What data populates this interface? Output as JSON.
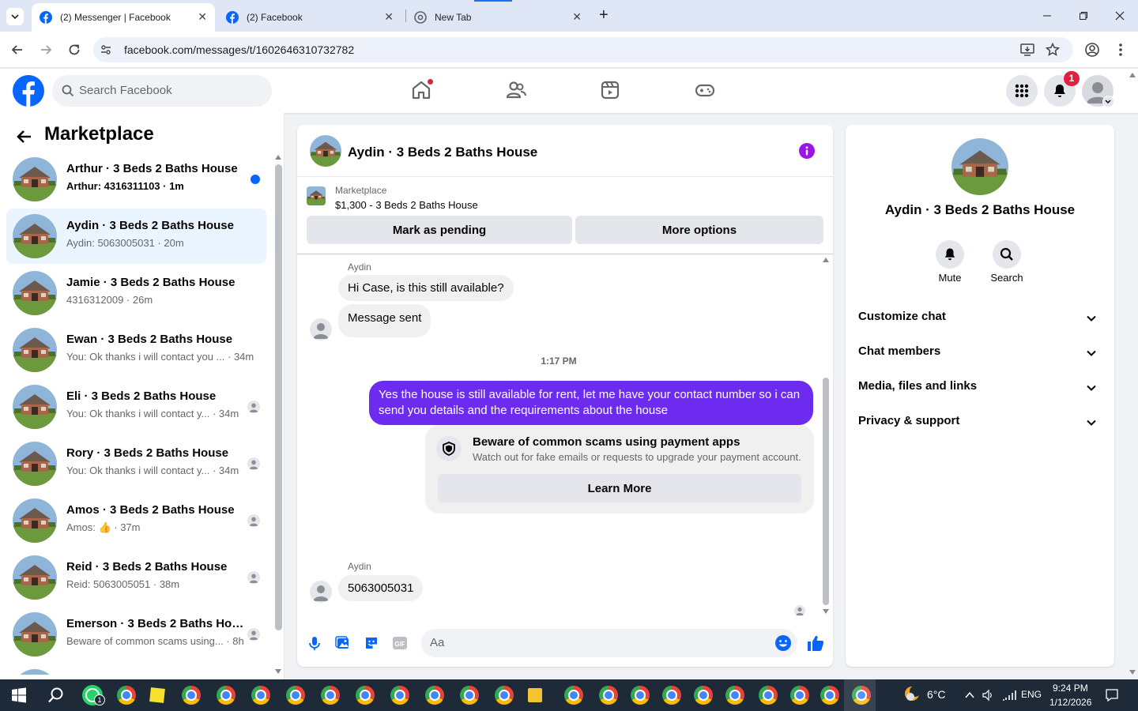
{
  "browser": {
    "tabs": [
      {
        "title": "(2) Messenger | Facebook",
        "active": true
      },
      {
        "title": "(2) Facebook",
        "active": false
      },
      {
        "title": "New Tab",
        "active": false
      }
    ],
    "url": "facebook.com/messages/t/1602646310732782"
  },
  "fb": {
    "search_placeholder": "Search Facebook",
    "notifications_count": "1"
  },
  "left": {
    "title": "Marketplace",
    "conversations": [
      {
        "name": "Arthur · 3 Beds 2 Baths House",
        "preview": "Arthur: 4316311103 · 1m",
        "unread": true
      },
      {
        "name": "Aydin · 3 Beds 2 Baths House",
        "preview": "Aydin: 5063005031 · 20m",
        "selected": true
      },
      {
        "name": "Jamie · 3 Beds 2 Baths House",
        "preview": "4316312009 · 26m"
      },
      {
        "name": "Ewan · 3 Beds 2 Baths House",
        "preview": "You: Ok thanks i will contact you ... · 34m"
      },
      {
        "name": "Eli · 3 Beds 2 Baths House",
        "preview": "You: Ok thanks i will contact y... · 34m"
      },
      {
        "name": "Rory · 3 Beds 2 Baths House",
        "preview": "You: Ok thanks i will contact y... · 34m"
      },
      {
        "name": "Amos · 3 Beds 2 Baths House",
        "preview": "Amos: 👍 · 37m"
      },
      {
        "name": "Reid · 3 Beds 2 Baths House",
        "preview": "Reid: 5063005051 · 38m"
      },
      {
        "name": "Emerson · 3 Beds 2 Baths Hou...",
        "preview": "Beware of common scams using... · 8h"
      }
    ]
  },
  "chat": {
    "title": "Aydin · 3 Beds 2 Baths House",
    "listing_source": "Marketplace",
    "listing_detail": "$1,300 - 3 Beds 2 Baths House",
    "mark_pending": "Mark as pending",
    "more_options": "More options",
    "sender1": "Aydin",
    "msg1": "Hi Case, is this still available?",
    "msg2": "Message sent",
    "timestamp": "1:17 PM",
    "my_msg": "Yes the house is still available for rent, let me have your contact number so i can send you details and the requirements about the house",
    "scam_title": "Beware of common scams using payment apps",
    "scam_body": "Watch out for fake emails or requests to upgrade your payment account.",
    "learn_more": "Learn More",
    "sender2": "Aydin",
    "msg3": "5063005031",
    "composer_placeholder": "Aa"
  },
  "right": {
    "name": "Aydin · 3 Beds 2 Baths House",
    "mute": "Mute",
    "search": "Search",
    "sections": [
      "Customize chat",
      "Chat members",
      "Media, files and links",
      "Privacy & support"
    ]
  },
  "taskbar": {
    "weather": "6°C",
    "lang": "ENG",
    "time": "9:24 PM",
    "date": "1/12/2026"
  },
  "colors": {
    "fb_blue": "#0866ff",
    "my_bubble": "#6c2bef",
    "unread_dot": "#0866ff"
  }
}
